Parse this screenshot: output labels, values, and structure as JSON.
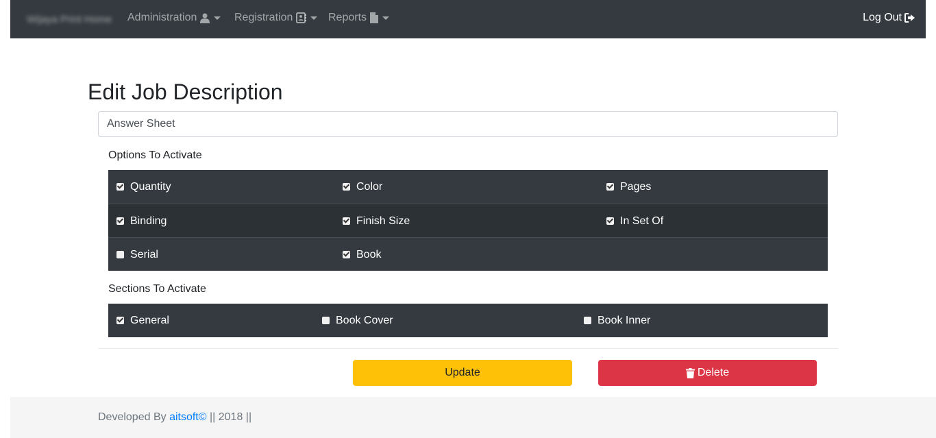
{
  "navbar": {
    "brand": "Wijaya Print Home",
    "items": [
      {
        "label": "Administration",
        "icon": "user-icon"
      },
      {
        "label": "Registration",
        "icon": "address-book-icon"
      },
      {
        "label": "Reports",
        "icon": "file-icon"
      }
    ],
    "logout_label": "Log Out",
    "logout_icon": "sign-out-icon"
  },
  "page": {
    "title": "Edit Job Description"
  },
  "job_name": {
    "value": "Answer Sheet"
  },
  "options": {
    "label": "Options To Activate",
    "rows": [
      [
        {
          "label": "Quantity",
          "checked": true
        },
        {
          "label": "Color",
          "checked": true
        },
        {
          "label": "Pages",
          "checked": true
        }
      ],
      [
        {
          "label": "Binding",
          "checked": true
        },
        {
          "label": "Finish Size",
          "checked": true
        },
        {
          "label": "In Set Of",
          "checked": true
        }
      ],
      [
        {
          "label": "Serial",
          "checked": false
        },
        {
          "label": "Book",
          "checked": true
        }
      ]
    ]
  },
  "sections": {
    "label": "Sections To Activate",
    "items": [
      {
        "label": "General",
        "checked": true
      },
      {
        "label": "Book Cover",
        "checked": false
      },
      {
        "label": "Book Inner",
        "checked": false
      }
    ]
  },
  "actions": {
    "update_label": "Update",
    "delete_label": "Delete",
    "delete_icon": "trash-icon"
  },
  "footer": {
    "prefix": "Developed By ",
    "link": "aitsoft©",
    "suffix": " || 2018 ||"
  },
  "colors": {
    "navbar": "#343a40",
    "update": "#ffc107",
    "delete": "#dc3545",
    "link": "#007bff"
  }
}
